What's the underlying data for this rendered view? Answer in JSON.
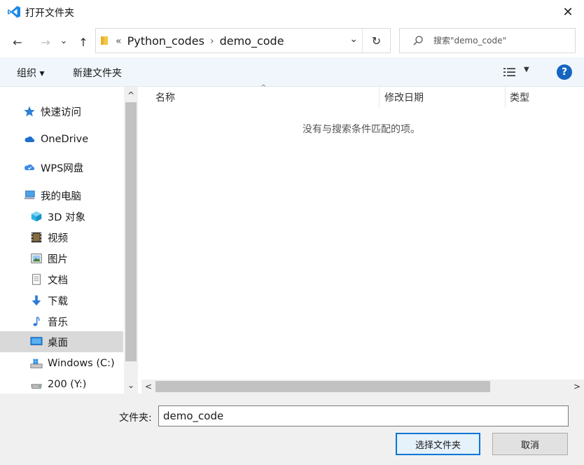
{
  "window": {
    "title": "打开文件夹",
    "close_glyph": "✕"
  },
  "nav": {
    "back_glyph": "←",
    "forward_glyph": "→",
    "recent_glyph": "⌄",
    "up_glyph": "↑",
    "breadcrumb_prefix": "«",
    "breadcrumb": [
      "Python_codes",
      "demo_code"
    ],
    "breadcrumb_sep": "›",
    "dropdown_glyph": "⌄",
    "refresh_glyph": "↻",
    "search_placeholder": "搜索\"demo_code\""
  },
  "toolbar": {
    "organize_label": "组织 ▾",
    "new_folder_label": "新建文件夹",
    "view_dropdown_glyph": "▼",
    "help_glyph": "?"
  },
  "sidebar": {
    "items": [
      {
        "label": "快速访问",
        "icon": "star-icon"
      },
      {
        "label": "OneDrive",
        "icon": "cloud-icon"
      },
      {
        "label": "WPS网盘",
        "icon": "wps-cloud-icon"
      },
      {
        "label": "我的电脑",
        "icon": "computer-icon"
      },
      {
        "label": "3D 对象",
        "icon": "cube-icon"
      },
      {
        "label": "视频",
        "icon": "film-icon"
      },
      {
        "label": "图片",
        "icon": "picture-icon"
      },
      {
        "label": "文档",
        "icon": "document-icon"
      },
      {
        "label": "下载",
        "icon": "download-arrow-icon"
      },
      {
        "label": "音乐",
        "icon": "music-note-icon"
      },
      {
        "label": "桌面",
        "icon": "desktop-icon",
        "selected": true
      },
      {
        "label": "Windows (C:)",
        "icon": "windows-drive-icon"
      },
      {
        "label": "200 (Y:)",
        "icon": "drive-icon"
      }
    ],
    "scroll_up_glyph": "^",
    "scroll_down_glyph": "⌄"
  },
  "main": {
    "columns": [
      "名称",
      "修改日期",
      "类型"
    ],
    "sort_glyph": "^",
    "empty_message": "没有与搜索条件匹配的项。",
    "scroll_left_glyph": "<",
    "scroll_right_glyph": ">"
  },
  "bottom": {
    "folder_label": "文件夹:",
    "folder_value": "demo_code",
    "select_button": "选择文件夹",
    "cancel_button": "取消"
  },
  "colors": {
    "accent": "#0078d7",
    "toolbar_bg": "#f0f6fc",
    "selected_bg": "#d9d9d9"
  }
}
